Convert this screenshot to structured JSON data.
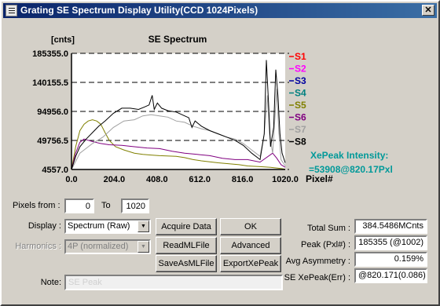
{
  "window": {
    "title": "Grating SE Spectrum Display Utility(CCD 1024Pixels)"
  },
  "chart_data": {
    "type": "line",
    "title": "SE Spectrum",
    "ylabel": "[cnts]",
    "xlabel": "Pixel#",
    "xlim": [
      0,
      1020
    ],
    "ylim": [
      4557.0,
      185355.0
    ],
    "x_ticks": [
      "0.0",
      "204.0",
      "408.0",
      "612.0",
      "816.0",
      "1020.0"
    ],
    "y_ticks": [
      "185355.0",
      "140155.5",
      "94956.0",
      "49756.5",
      "4557.0"
    ],
    "legend_position": "right",
    "grid": "horizontal dashed",
    "series": [
      {
        "name": "S1",
        "color": "#ff0000",
        "points": [
          [
            0,
            4557
          ],
          [
            1020,
            4557
          ]
        ]
      },
      {
        "name": "S2",
        "color": "#ff00ff",
        "points": [
          [
            0,
            4557
          ],
          [
            1020,
            4557
          ]
        ]
      },
      {
        "name": "S3",
        "color": "#0000a0",
        "points": [
          [
            0,
            4557
          ],
          [
            1020,
            4557
          ]
        ]
      },
      {
        "name": "S4",
        "color": "#008080",
        "points": [
          [
            0,
            4557
          ],
          [
            1020,
            4557
          ]
        ]
      },
      {
        "name": "S5",
        "color": "#808000",
        "points": [
          [
            0,
            4557
          ],
          [
            20,
            40000
          ],
          [
            40,
            65000
          ],
          [
            60,
            75000
          ],
          [
            80,
            80000
          ],
          [
            100,
            82000
          ],
          [
            120,
            80000
          ],
          [
            140,
            75000
          ],
          [
            160,
            62000
          ],
          [
            180,
            50000
          ],
          [
            210,
            40000
          ],
          [
            250,
            35000
          ],
          [
            300,
            30000
          ],
          [
            340,
            28000
          ],
          [
            380,
            27000
          ],
          [
            420,
            26000
          ],
          [
            500,
            25000
          ],
          [
            540,
            23000
          ],
          [
            580,
            20000
          ],
          [
            620,
            18000
          ],
          [
            700,
            15000
          ],
          [
            800,
            12000
          ],
          [
            840,
            10000
          ],
          [
            900,
            9000
          ],
          [
            950,
            8000
          ],
          [
            1000,
            6000
          ],
          [
            1020,
            5000
          ]
        ]
      },
      {
        "name": "S6",
        "color": "#800080",
        "points": [
          [
            0,
            4557
          ],
          [
            20,
            30000
          ],
          [
            40,
            47000
          ],
          [
            60,
            52000
          ],
          [
            80,
            50000
          ],
          [
            100,
            48000
          ],
          [
            140,
            45000
          ],
          [
            180,
            43000
          ],
          [
            240,
            42000
          ],
          [
            300,
            40000
          ],
          [
            360,
            38000
          ],
          [
            420,
            37000
          ],
          [
            480,
            33000
          ],
          [
            540,
            30000
          ],
          [
            600,
            28000
          ],
          [
            660,
            26000
          ],
          [
            720,
            22000
          ],
          [
            780,
            20000
          ],
          [
            840,
            20000
          ],
          [
            900,
            16000
          ],
          [
            960,
            30000
          ],
          [
            980,
            22000
          ],
          [
            1000,
            12000
          ],
          [
            1020,
            8000
          ]
        ]
      },
      {
        "name": "S7",
        "color": "#a0a0a0",
        "points": [
          [
            0,
            4557
          ],
          [
            40,
            30000
          ],
          [
            100,
            45000
          ],
          [
            150,
            55000
          ],
          [
            200,
            70000
          ],
          [
            250,
            80000
          ],
          [
            300,
            82000
          ],
          [
            340,
            88000
          ],
          [
            380,
            90000
          ],
          [
            420,
            88000
          ],
          [
            460,
            86000
          ],
          [
            500,
            80000
          ],
          [
            540,
            78000
          ],
          [
            580,
            72000
          ],
          [
            620,
            68000
          ],
          [
            660,
            65000
          ],
          [
            700,
            60000
          ],
          [
            740,
            55000
          ],
          [
            780,
            52000
          ],
          [
            820,
            45000
          ],
          [
            860,
            35000
          ],
          [
            900,
            25000
          ],
          [
            920,
            60000
          ],
          [
            935,
            120000
          ],
          [
            945,
            60000
          ],
          [
            960,
            30000
          ],
          [
            980,
            130000
          ],
          [
            990,
            60000
          ],
          [
            1000,
            20000
          ],
          [
            1020,
            10000
          ]
        ]
      },
      {
        "name": "S8",
        "color": "#000000",
        "points": [
          [
            0,
            4557
          ],
          [
            20,
            25000
          ],
          [
            40,
            40000
          ],
          [
            70,
            52000
          ],
          [
            100,
            62000
          ],
          [
            130,
            72000
          ],
          [
            160,
            80000
          ],
          [
            200,
            92000
          ],
          [
            240,
            100000
          ],
          [
            280,
            100000
          ],
          [
            320,
            98000
          ],
          [
            350,
            102000
          ],
          [
            370,
            105000
          ],
          [
            385,
            120000
          ],
          [
            395,
            98000
          ],
          [
            410,
            108000
          ],
          [
            430,
            100000
          ],
          [
            460,
            96000
          ],
          [
            500,
            94000
          ],
          [
            540,
            88000
          ],
          [
            560,
            85000
          ],
          [
            575,
            70000
          ],
          [
            590,
            80000
          ],
          [
            620,
            72000
          ],
          [
            660,
            65000
          ],
          [
            700,
            60000
          ],
          [
            740,
            55000
          ],
          [
            780,
            50000
          ],
          [
            820,
            42000
          ],
          [
            860,
            30000
          ],
          [
            900,
            20000
          ],
          [
            920,
            60000
          ],
          [
            930,
            175000
          ],
          [
            940,
            110000
          ],
          [
            950,
            40000
          ],
          [
            965,
            70000
          ],
          [
            975,
            160000
          ],
          [
            985,
            120000
          ],
          [
            995,
            60000
          ],
          [
            1005,
            30000
          ],
          [
            1020,
            15000
          ]
        ]
      }
    ],
    "annotation": {
      "title": "XePeak Intensity:",
      "value": "=53908@820.17Pxl",
      "color": "#009999"
    }
  },
  "controls": {
    "pixels_from": {
      "label": "Pixels from :",
      "value": "0"
    },
    "pixels_to": {
      "label": "To",
      "value": "1020"
    },
    "display": {
      "label": "Display :",
      "value": "Spectrum (Raw)"
    },
    "harmonics": {
      "label": "Harmonics :",
      "value": "4P (normalized)"
    },
    "note": {
      "label": "Note:",
      "value": "SE Peak"
    }
  },
  "buttons": {
    "acquire": "Acquire Data",
    "ok": "OK",
    "read_ml": "ReadMLFile",
    "advanced": "Advanced",
    "save_as_ml": "SaveAsMLFile",
    "export_xe": "ExportXePeak"
  },
  "stats": {
    "total_sum": {
      "label": "Total Sum :",
      "value": "384.5486MCnts"
    },
    "peak": {
      "label": "Peak (Pxl#) :",
      "value": "185355 (@1002)"
    },
    "avg_asymmetry": {
      "label": "Avg Asymmetry :",
      "value": "0.159%"
    },
    "se_xepeak": {
      "label": "SE XePeak(Err) :",
      "value": "@820.171(0.086)"
    }
  }
}
